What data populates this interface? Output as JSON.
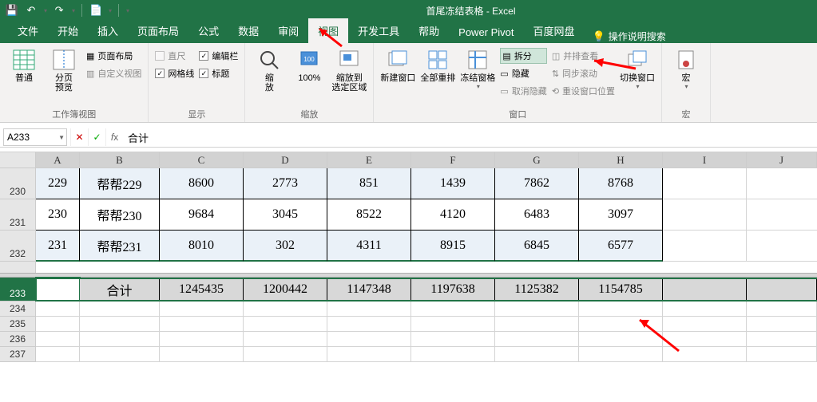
{
  "title": "首尾冻结表格 - Excel",
  "qat": {
    "save": "💾",
    "undo": "↶",
    "redo": "↷",
    "touch": "📄"
  },
  "tabs": [
    "文件",
    "开始",
    "插入",
    "页面布局",
    "公式",
    "数据",
    "审阅",
    "视图",
    "开发工具",
    "帮助",
    "Power Pivot",
    "百度网盘"
  ],
  "active_tab": "视图",
  "search_hint": "操作说明搜索",
  "ribbon": {
    "views": {
      "normal": "普通",
      "pagebreak": "分页\n预览",
      "pagelayout": "页面布局",
      "custom": "自定义视图",
      "label": "工作簿视图"
    },
    "show": {
      "ruler": "直尺",
      "formulabar": "编辑栏",
      "gridlines": "网格线",
      "headings": "标题",
      "label": "显示"
    },
    "zoom": {
      "zoom": "缩\n放",
      "hundred": "100%",
      "tosel": "缩放到\n选定区域",
      "label": "缩放"
    },
    "window": {
      "neww": "新建窗口",
      "arrange": "全部重排",
      "freeze": "冻结窗格",
      "split": "拆分",
      "hide": "隐藏",
      "unhide": "取消隐藏",
      "sidebyside": "并排查看",
      "syncscroll": "同步滚动",
      "resetpos": "重设窗口位置",
      "switch": "切换窗口",
      "label": "窗口"
    },
    "macros": {
      "macro": "宏",
      "label": "宏"
    }
  },
  "namebox": "A233",
  "formula": "合计",
  "columns": [
    "A",
    "B",
    "C",
    "D",
    "E",
    "F",
    "G",
    "H",
    "I",
    "J"
  ],
  "rowheads_top": [
    "230",
    "231",
    "232"
  ],
  "rowheads_bot": [
    "233",
    "234",
    "235",
    "236",
    "237"
  ],
  "data_rows": [
    {
      "a": "229",
      "b": "帮帮229",
      "c": "8600",
      "d": "2773",
      "e": "851",
      "f": "1439",
      "g": "7862",
      "h": "8768",
      "bg": "blue"
    },
    {
      "a": "230",
      "b": "帮帮230",
      "c": "9684",
      "d": "3045",
      "e": "8522",
      "f": "4120",
      "g": "6483",
      "h": "3097",
      "bg": "white"
    },
    {
      "a": "231",
      "b": "帮帮231",
      "c": "8010",
      "d": "302",
      "e": "4311",
      "f": "8915",
      "g": "6845",
      "h": "6577",
      "bg": "blue"
    }
  ],
  "total_row": {
    "a": "",
    "b": "合计",
    "c": "1245435",
    "d": "1200442",
    "e": "1147348",
    "f": "1197638",
    "g": "1125382",
    "h": "1154785"
  },
  "chart_data": {
    "type": "table",
    "title": "首尾冻结表格",
    "columns": [
      "A",
      "B",
      "C",
      "D",
      "E",
      "F",
      "G",
      "H"
    ],
    "rows": [
      [
        "229",
        "帮帮229",
        8600,
        2773,
        851,
        1439,
        7862,
        8768
      ],
      [
        "230",
        "帮帮230",
        9684,
        3045,
        8522,
        4120,
        6483,
        3097
      ],
      [
        "231",
        "帮帮231",
        8010,
        302,
        4311,
        8915,
        6845,
        6577
      ],
      [
        "",
        "合计",
        1245435,
        1200442,
        1147348,
        1197638,
        1125382,
        1154785
      ]
    ]
  }
}
